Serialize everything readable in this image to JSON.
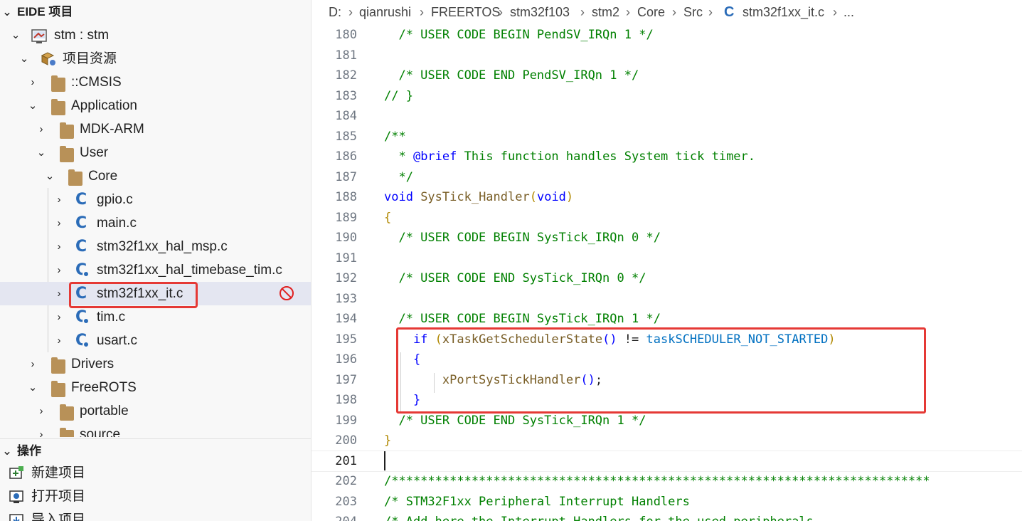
{
  "sidebar": {
    "project_header": "EIDE 项目",
    "project_chevron": "⌄",
    "tree": [
      {
        "label": "stm : stm",
        "twisty": "⌄",
        "icon": "project-icon"
      },
      {
        "label": "项目资源",
        "twisty": "⌄",
        "icon": "resources-icon"
      },
      {
        "label": "::CMSIS",
        "twisty": "›",
        "icon": "folder-icon"
      },
      {
        "label": "Application",
        "twisty": "⌄",
        "icon": "folder-icon"
      },
      {
        "label": "MDK-ARM",
        "twisty": "›",
        "icon": "folder-icon"
      },
      {
        "label": "User",
        "twisty": "⌄",
        "icon": "folder-icon"
      },
      {
        "label": "Core",
        "twisty": "⌄",
        "icon": "folder-icon"
      },
      {
        "label": "gpio.c",
        "twisty": "›",
        "icon": "c-file-icon"
      },
      {
        "label": "main.c",
        "twisty": "›",
        "icon": "c-file-icon"
      },
      {
        "label": "stm32f1xx_hal_msp.c",
        "twisty": "›",
        "icon": "c-file-icon"
      },
      {
        "label": "stm32f1xx_hal_timebase_tim.c",
        "twisty": "›",
        "icon": "c-file-gear-icon"
      },
      {
        "label": "stm32f1xx_it.c",
        "twisty": "›",
        "icon": "c-file-icon"
      },
      {
        "label": "tim.c",
        "twisty": "›",
        "icon": "c-file-gear-icon"
      },
      {
        "label": "usart.c",
        "twisty": "›",
        "icon": "c-file-gear-icon"
      },
      {
        "label": "Drivers",
        "twisty": "›",
        "icon": "folder-icon"
      },
      {
        "label": "FreeROTS",
        "twisty": "⌄",
        "icon": "folder-icon"
      },
      {
        "label": "portable",
        "twisty": "›",
        "icon": "folder-icon"
      },
      {
        "label": "source",
        "twisty": "›",
        "icon": "folder-icon"
      }
    ],
    "c_glyph": "C",
    "actions_header": "操作",
    "actions_chevron": "⌄",
    "actions": [
      {
        "label": "新建项目",
        "icon": "new-project-icon"
      },
      {
        "label": "打开项目",
        "icon": "open-project-icon"
      },
      {
        "label": "导入项目",
        "icon": "import-project-icon"
      }
    ]
  },
  "breadcrumb": {
    "items": [
      "D:",
      "qianrushi",
      "FREERTOS",
      "stm32f103",
      "stm2",
      "Core",
      "Src",
      "stm32f1xx_it.c",
      "..."
    ],
    "separator": "›",
    "file_glyph": "C"
  },
  "editor": {
    "active_line": "201",
    "lines": [
      {
        "n": "180",
        "t": "  /* USER CODE BEGIN PendSV_IRQn 1 */"
      },
      {
        "n": "181",
        "t": ""
      },
      {
        "n": "182",
        "t": "  /* USER CODE END PendSV_IRQn 1 */"
      },
      {
        "n": "183",
        "t": "// }"
      },
      {
        "n": "184",
        "t": ""
      },
      {
        "n": "185",
        "t": "/**"
      },
      {
        "n": "186",
        "a": "  * ",
        "b": "@brief",
        "c": " This function handles System tick timer."
      },
      {
        "n": "187",
        "t": "  */"
      },
      {
        "n": "188",
        "a": "void",
        "b": " SysTick_Handler",
        "c": "(",
        "d": "void",
        "e": ")"
      },
      {
        "n": "189",
        "t": "{"
      },
      {
        "n": "190",
        "t": "  /* USER CODE BEGIN SysTick_IRQn 0 */"
      },
      {
        "n": "191",
        "t": ""
      },
      {
        "n": "192",
        "t": "  /* USER CODE END SysTick_IRQn 0 */"
      },
      {
        "n": "193",
        "t": ""
      },
      {
        "n": "194",
        "t": "  /* USER CODE BEGIN SysTick_IRQn 1 */"
      },
      {
        "n": "195",
        "a": "    if",
        "b": " (",
        "c": "xTaskGetSchedulerState",
        "d": "()",
        "e": " != ",
        "f": "taskSCHEDULER_NOT_STARTED",
        "g": ")"
      },
      {
        "n": "196",
        "t": "    {"
      },
      {
        "n": "197",
        "a": "        xPortSysTickHandler",
        "b": "()",
        "c": ";"
      },
      {
        "n": "198",
        "t": "    }"
      },
      {
        "n": "199",
        "t": "  /* USER CODE END SysTick_IRQn 1 */"
      },
      {
        "n": "200",
        "t": "}"
      },
      {
        "n": "201",
        "t": ""
      },
      {
        "n": "202",
        "t": "/**************************************************************************"
      },
      {
        "n": "203",
        "t": "/* STM32F1xx Peripheral Interrupt Handlers"
      },
      {
        "n": "204",
        "t": "/* Add here the Interrupt Handlers for the used peripherals."
      }
    ]
  },
  "colors": {
    "comment": "#008000",
    "keyword": "#0000ff",
    "function": "#795e26",
    "macro": "#0070c1",
    "highlight": "#e53935",
    "c_icon": "#2b6cb8",
    "folder": "#b89158"
  }
}
